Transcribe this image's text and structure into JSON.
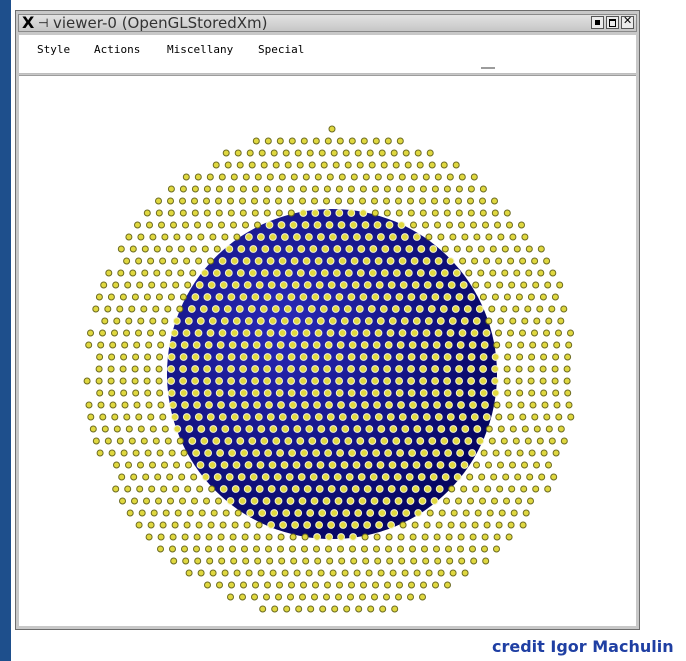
{
  "window": {
    "title": "viewer-0 (OpenGLStoredXm)",
    "x_logo": "X",
    "pin_glyph": "⊣"
  },
  "menu": {
    "items": [
      "Style",
      "Actions",
      "Miscellany",
      "Special"
    ]
  },
  "viewer": {
    "sphere_color": "#0a0a8c",
    "arrow_color": "#e0d840"
  },
  "credit": "credit Igor Machulin"
}
